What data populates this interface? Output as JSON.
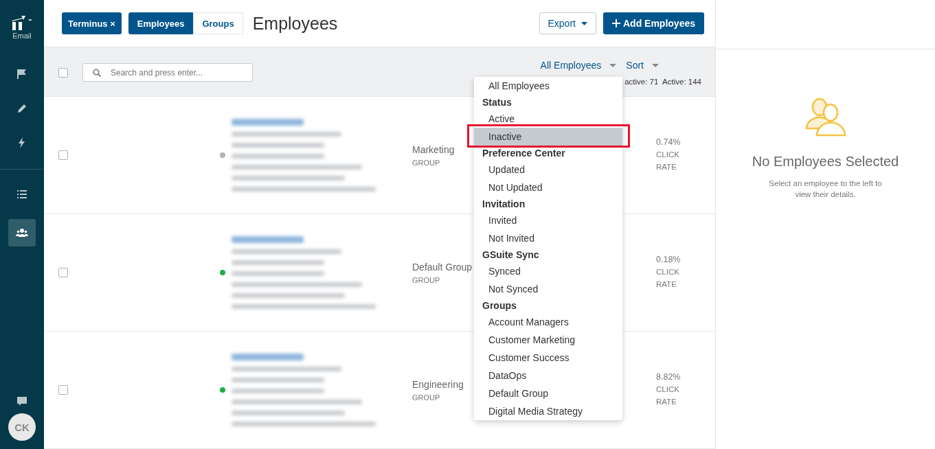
{
  "sidebar": {
    "app_label": "Email",
    "items": [
      {
        "kind": "flag",
        "selected": false
      },
      {
        "kind": "pen",
        "selected": false
      },
      {
        "kind": "bolt",
        "selected": false
      },
      {
        "kind": "list",
        "selected": false
      },
      {
        "kind": "people",
        "selected": true
      }
    ],
    "avatar": "CK"
  },
  "header": {
    "filter_chip": "Terminus ×",
    "tabs": [
      {
        "label": "Employees",
        "selected": true
      },
      {
        "label": "Groups",
        "selected": false
      }
    ],
    "title": "Employees",
    "export_button": "Export",
    "add_button": "Add Employees"
  },
  "toolbar": {
    "select_all_checked": false,
    "search": {
      "placeholder": "Search and press enter..."
    },
    "filter": "All Employees",
    "sort": "Sort",
    "counts": "active: 71  Active: 144"
  },
  "employees": [
    {
      "checked": false,
      "color": "#b0b3b7",
      "group": "Marketing",
      "group_label": "GROUP",
      "rate": "0.74%",
      "rate_label": "CLICK RATE"
    },
    {
      "checked": false,
      "color": "#1fae4a",
      "group": "Default Group",
      "group_label": "GROUP",
      "rate": "0.18%",
      "rate_label": "CLICK RATE"
    },
    {
      "checked": false,
      "color": "#1fae4a",
      "group": "Engineering",
      "group_label": "GROUP",
      "rate": "8.82%",
      "rate_label": "CLICK RATE"
    }
  ],
  "filter_menu": [
    {
      "kind": "option",
      "label": "All Employees",
      "selected": false
    },
    {
      "kind": "heading",
      "label": "Status"
    },
    {
      "kind": "option",
      "label": "Active",
      "selected": false
    },
    {
      "kind": "option",
      "label": "Inactive",
      "selected": true
    },
    {
      "kind": "heading",
      "label": "Preference Center"
    },
    {
      "kind": "option",
      "label": "Updated",
      "selected": false
    },
    {
      "kind": "option",
      "label": "Not Updated",
      "selected": false
    },
    {
      "kind": "heading",
      "label": "Invitation"
    },
    {
      "kind": "option",
      "label": "Invited",
      "selected": false
    },
    {
      "kind": "option",
      "label": "Not Invited",
      "selected": false
    },
    {
      "kind": "heading",
      "label": "GSuite Sync"
    },
    {
      "kind": "option",
      "label": "Synced",
      "selected": false
    },
    {
      "kind": "option",
      "label": "Not Synced",
      "selected": false
    },
    {
      "kind": "heading",
      "label": "Groups"
    },
    {
      "kind": "option",
      "label": "Account Managers",
      "selected": false
    },
    {
      "kind": "option",
      "label": "Customer Marketing",
      "selected": false
    },
    {
      "kind": "option",
      "label": "Customer Success",
      "selected": false
    },
    {
      "kind": "option",
      "label": "DataOps",
      "selected": false
    },
    {
      "kind": "option",
      "label": "Default Group",
      "selected": false
    },
    {
      "kind": "option",
      "label": "Digital Media Strategy",
      "selected": false
    }
  ],
  "detail_panel": {
    "title": "No Employees Selected",
    "message": "Select an employee to the left to view their details."
  }
}
